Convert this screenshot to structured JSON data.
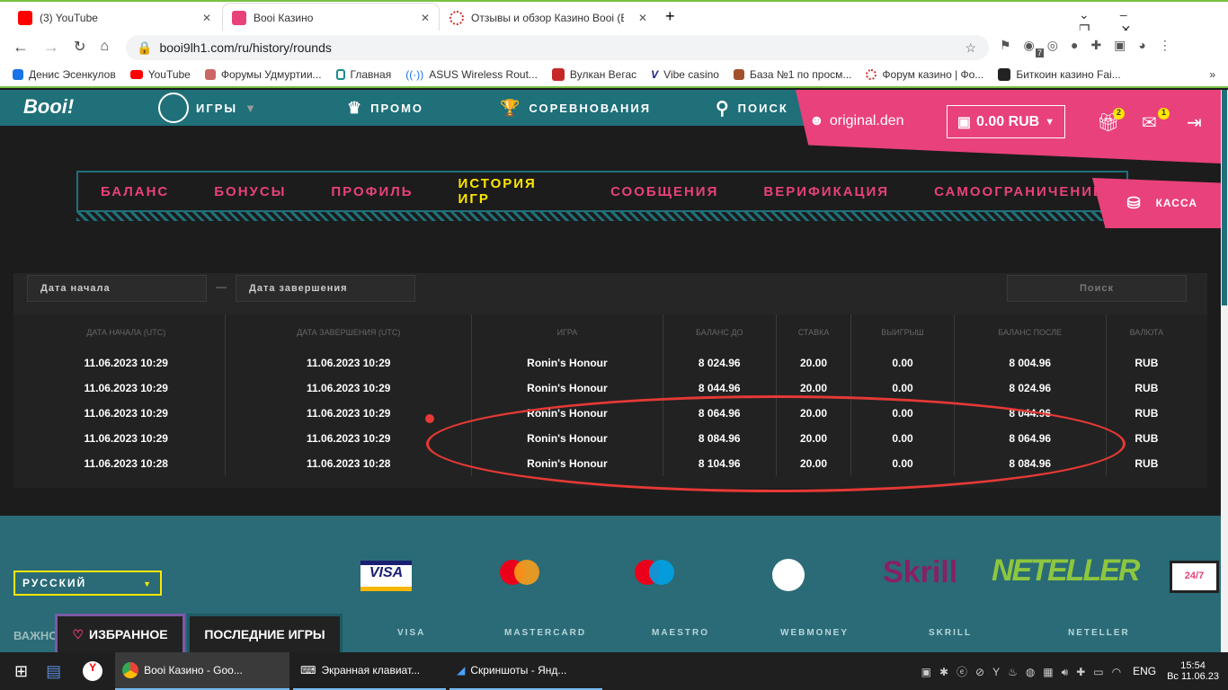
{
  "browser": {
    "tabs": [
      {
        "title": "(3) YouTube",
        "color": "#ff0000"
      },
      {
        "title": "Booi Казино",
        "color": "#e8417b"
      },
      {
        "title": "Отзывы и обзор Казино Booi (B",
        "color": "#d32f2f"
      }
    ],
    "url": "booi9lh1.com/ru/history/rounds",
    "bookmarks": [
      "Денис Эсенкулов",
      "YouTube",
      "Форумы Удмуртии...",
      "Главная",
      "ASUS Wireless Rout...",
      "Вулкан Вегас",
      "Vibe casino",
      "База №1 по просм...",
      "Форум казино | Фо...",
      "Биткоин казино Fai..."
    ],
    "ext_badge": "7"
  },
  "site": {
    "logo": "Booi!",
    "nav": [
      "ИГРЫ",
      "ПРОМО",
      "СОРЕВНОВАНИЯ",
      "ПОИСК"
    ],
    "username": "original.den",
    "balance": "0.00 RUB",
    "gift_count": "2",
    "mail_count": "1",
    "account_tabs": [
      "БАЛАНС",
      "БОНУСЫ",
      "ПРОФИЛЬ",
      "ИСТОРИЯ ИГР",
      "СООБЩЕНИЯ",
      "ВЕРИФИКАЦИЯ",
      "САМООГРАНИЧЕНИЕ"
    ],
    "kassa": "КАССА",
    "filters": {
      "start": "Дата начала",
      "end": "Дата завершения",
      "dash": "—",
      "search": "Поиск"
    },
    "table": {
      "headers": [
        "ДАТА НАЧАЛА (UTC)",
        "ДАТА ЗАВЕРШЕНИЯ (UTC)",
        "ИГРА",
        "БАЛАНС ДО",
        "СТАВКА",
        "ВЫИГРЫШ",
        "БАЛАНС ПОСЛЕ",
        "ВАЛЮТА"
      ],
      "rows": [
        [
          "11.06.2023 10:29",
          "11.06.2023 10:29",
          "Ronin's Honour",
          "8 024.96",
          "20.00",
          "0.00",
          "8 004.96",
          "RUB"
        ],
        [
          "11.06.2023 10:29",
          "11.06.2023 10:29",
          "Ronin's Honour",
          "8 044.96",
          "20.00",
          "0.00",
          "8 024.96",
          "RUB"
        ],
        [
          "11.06.2023 10:29",
          "11.06.2023 10:29",
          "Ronin's Honour",
          "8 064.96",
          "20.00",
          "0.00",
          "8 044.96",
          "RUB"
        ],
        [
          "11.06.2023 10:29",
          "11.06.2023 10:29",
          "Ronin's Honour",
          "8 084.96",
          "20.00",
          "0.00",
          "8 064.96",
          "RUB"
        ],
        [
          "11.06.2023 10:28",
          "11.06.2023 10:28",
          "Ronin's Honour",
          "8 104.96",
          "20.00",
          "0.00",
          "8 084.96",
          "RUB"
        ]
      ]
    },
    "footer": {
      "language": "РУССКИЙ",
      "important": "ВАЖНО",
      "favorites": "ИЗБРАННОЕ",
      "recent": "ПОСЛЕДНИЕ ИГРЫ",
      "payments": [
        "VISA",
        "MASTERCARD",
        "MAESTRO",
        "WEBMONEY",
        "SKRILL",
        "NETELLER"
      ],
      "logos": {
        "visa": "VISA",
        "skrill": "Skrill",
        "neteller": "NETELLER",
        "support": "24/7"
      }
    }
  },
  "taskbar": {
    "apps": [
      "Booi Казино - Goo...",
      "Экранная клавиат...",
      "Скриншоты - Янд..."
    ],
    "lang": "ENG",
    "time": "15:54",
    "date": "Вс 11.06.23"
  }
}
